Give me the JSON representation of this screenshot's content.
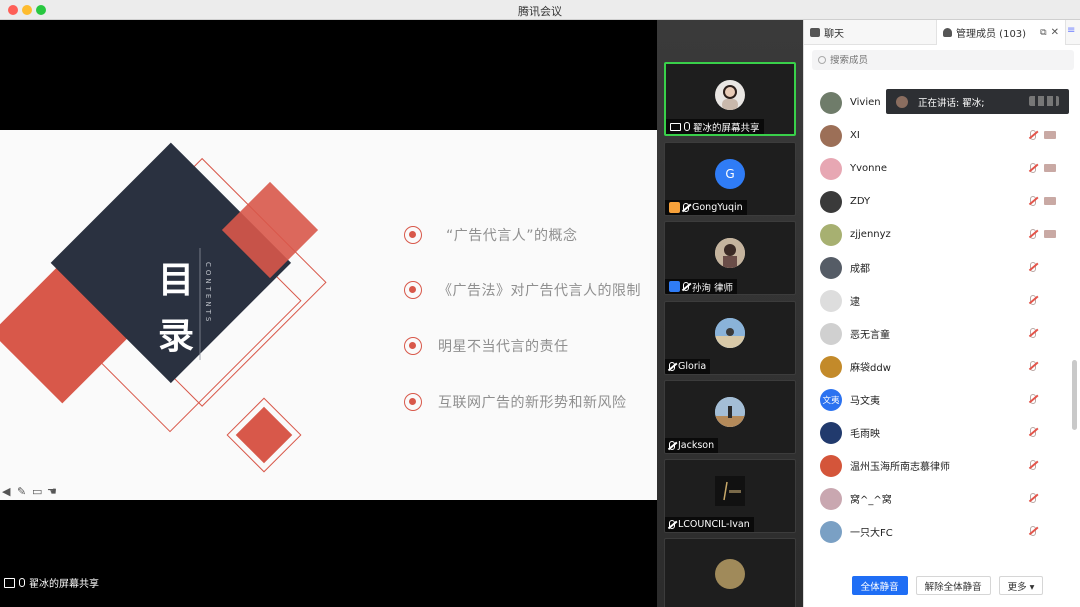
{
  "window": {
    "title": "腾讯会议"
  },
  "slide": {
    "title_char_1": "目",
    "title_char_2": "录",
    "contents_label": "CONTENTS",
    "items": [
      "“广告代言人”的概念",
      "《广告法》对广告代言人的限制",
      "明星不当代言的责任",
      "互联网广告的新形势和新风险"
    ],
    "accent_color": "#d8584a",
    "dark_color": "#2a3140"
  },
  "stage_footer": {
    "label": "翟冰的屏幕共享"
  },
  "video_tiles": [
    {
      "name": "翟冰的屏幕共享",
      "type": "share",
      "active": true
    },
    {
      "name": "GongYuqin",
      "initial": "G",
      "type": "person-orange"
    },
    {
      "name": "孙洵 律师",
      "type": "person-blue"
    },
    {
      "name": "Gloria",
      "type": "muted"
    },
    {
      "name": "Jackson",
      "type": "muted"
    },
    {
      "name": "LCOUNCIL-Ivan",
      "type": "muted"
    }
  ],
  "panel": {
    "tab_chat": "聊天",
    "tab_members": "管理成员 (103)",
    "search_placeholder": "搜索成员",
    "speaking_text": "正在讲话: 翟冰;",
    "members": [
      {
        "name": "Vivien",
        "color": "#6f7c6a"
      },
      {
        "name": "XI",
        "color": "#9c6f57",
        "cam": true
      },
      {
        "name": "Yvonne",
        "color": "#e7a7b3",
        "cam": true
      },
      {
        "name": "ZDY",
        "color": "#3a3a3a",
        "cam": true
      },
      {
        "name": "zjjennyz",
        "color": "#a7b071",
        "cam": true
      },
      {
        "name": "成都",
        "color": "#555c66"
      },
      {
        "name": "逮",
        "color": "#dddddd"
      },
      {
        "name": "恶无言童",
        "color": "#d0d0d0"
      },
      {
        "name": "麻袋ddw",
        "color": "#c38a2a"
      },
      {
        "name": "马文夷",
        "initial": "文夷",
        "color": "#2b72f0"
      },
      {
        "name": "毛雨映",
        "color": "#213a6d"
      },
      {
        "name": "温州玉海所南志慕律师",
        "color": "#d4553a"
      },
      {
        "name": "窝^_^窝",
        "color": "#c9a7b0"
      },
      {
        "name": "一只大FC",
        "color": "#7aa0c4"
      }
    ],
    "buttons": {
      "mute_all": "全体静音",
      "unmute_all": "解除全体静音",
      "more": "更多 ▾"
    }
  }
}
